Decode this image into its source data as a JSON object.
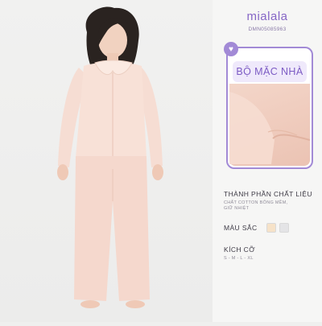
{
  "brand": {
    "name": "mialala",
    "sku": "DMN05085963"
  },
  "product_card": {
    "title": "BỘ MẶC NHÀ",
    "badge_icon": "heart-icon"
  },
  "sections": {
    "material": {
      "title": "THÀNH PHẦN CHẤT LIỆU",
      "line1": "CHẤT COTTON BÔNG MỀM,",
      "line2": "GIỮ NHIỆT"
    },
    "color": {
      "title": "MÀU SẮC",
      "swatches": [
        "#f6e2c8",
        "#e4e4e6"
      ]
    },
    "size": {
      "title": "KÍCH CỠ",
      "values": "S - M - L - XL"
    }
  },
  "colors": {
    "accent": "#a28ad6",
    "title_text": "#7c5bc4",
    "fabric": "#f3d6c9"
  }
}
